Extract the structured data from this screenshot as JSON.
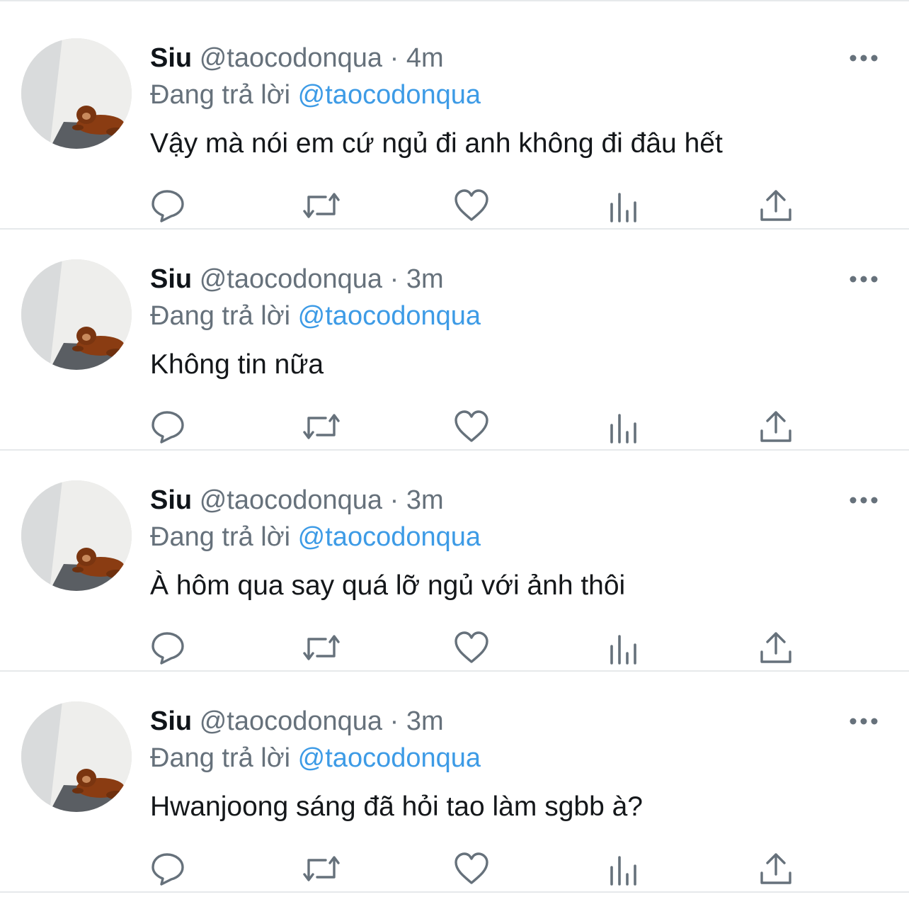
{
  "tweets": [
    {
      "name": "Siu",
      "handle": "@taocodonqua",
      "separator": "·",
      "time": "4m",
      "reply_prefix": "Đang trả lời",
      "reply_to": "@taocodonqua",
      "text": "Vậy mà nói em cứ ngủ đi anh không đi đâu hết"
    },
    {
      "name": "Siu",
      "handle": "@taocodonqua",
      "separator": "·",
      "time": "3m",
      "reply_prefix": "Đang trả lời",
      "reply_to": "@taocodonqua",
      "text": "Không tin nữa"
    },
    {
      "name": "Siu",
      "handle": "@taocodonqua",
      "separator": "·",
      "time": "3m",
      "reply_prefix": "Đang trả lời",
      "reply_to": "@taocodonqua",
      "text": "À hôm qua say quá lỡ ngủ với ảnh thôi"
    },
    {
      "name": "Siu",
      "handle": "@taocodonqua",
      "separator": "·",
      "time": "3m",
      "reply_prefix": "Đang trả lời",
      "reply_to": "@taocodonqua",
      "text": "Hwanjoong sáng đã hỏi tao làm sgbb à?"
    }
  ],
  "icons": {
    "reply": "reply-icon",
    "retweet": "retweet-icon",
    "like": "heart-icon",
    "views": "analytics-icon",
    "share": "share-icon",
    "more": "more-icon"
  },
  "colors": {
    "text": "#0f1419",
    "secondary": "#66717b",
    "mention": "#3d9be6",
    "divider": "#e6e9eb"
  }
}
